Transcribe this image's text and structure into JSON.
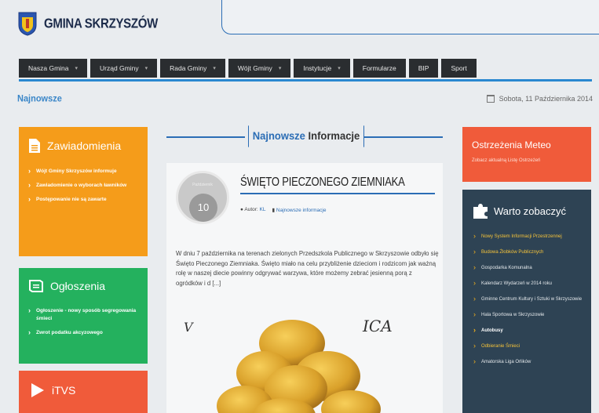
{
  "header": {
    "site_name": "GMINA SKRZYSZÓW"
  },
  "nav": {
    "items": [
      {
        "label": "Nasza Gmina",
        "has_dropdown": true
      },
      {
        "label": "Urząd Gminy",
        "has_dropdown": true
      },
      {
        "label": "Rada Gminy",
        "has_dropdown": true
      },
      {
        "label": "Wójt Gminy",
        "has_dropdown": true
      },
      {
        "label": "Instytucje",
        "has_dropdown": true
      },
      {
        "label": "Formularze",
        "has_dropdown": false
      },
      {
        "label": "BIP",
        "has_dropdown": false
      },
      {
        "label": "Sport",
        "has_dropdown": false
      }
    ]
  },
  "breadcrumb": "Najnowsze",
  "date": "Sobota, 11 Października 2014",
  "left": {
    "zawiadomienia": {
      "title": "Zawiadomienia",
      "items": [
        "Wójt Gminy Skrzyszów informuje",
        "Zawiadomienie o wyborach ławników",
        "Postępowanie nie są zawarte"
      ]
    },
    "ogloszenia": {
      "title": "Ogłoszenia",
      "items": [
        "Ogłoszenie - nowy sposób segregowania śmieci",
        "Zwrot podatku akcyzowego"
      ]
    },
    "itvs": {
      "title": "iTVS"
    }
  },
  "main": {
    "section_title_highlight": "Najnowsze",
    "section_title_rest": "Informacje",
    "article": {
      "day": "10",
      "month": "Październik",
      "title": "ŚWIĘTO PIECZONEGO ZIEMNIAKA",
      "author_label": "Autor:",
      "author_name": "KL",
      "category": "Najnowsze informacje",
      "body": "W dniu 7 października na terenach zielonych Przedszkola Publicznego w Skrzyszowie odbyło się Święto Pieczonego Ziemniaka. Święto miało na celu przybliżenie dzieciom i rodzicom jak ważną rolę w naszej diecie powinny odgrywać warzywa, które możemy zebrać jesienną porą z ogródków i d [...]",
      "image_text_left": "V",
      "image_text_right": "ICA"
    }
  },
  "right": {
    "meteo": {
      "title": "Ostrzeżenia Meteo",
      "subtitle": "Zobacz aktualną Listę Ostrzeżeń"
    },
    "warto": {
      "title": "Warto zobaczyć",
      "items": [
        {
          "label": "Nowy System Informacji Przestrzennej",
          "style": "y"
        },
        {
          "label": "Budowa Żłobków Publicznych",
          "style": "y"
        },
        {
          "label": "Gospodarka Komunalna",
          "style": "w"
        },
        {
          "label": "Kalendarz Wydarzeń w 2014 roku",
          "style": "w"
        },
        {
          "label": "Gminne Centrum Kultury i Sztuki w Skrzyszowie",
          "style": "w"
        },
        {
          "label": "Hala Sportowa w Skrzyszowie",
          "style": "w"
        },
        {
          "label": "Autobusy",
          "style": "b"
        },
        {
          "label": "Odbieranie Śmieci",
          "style": "y"
        },
        {
          "label": "Amatorska Liga Orlików",
          "style": "w"
        }
      ]
    }
  },
  "colors": {
    "accent_blue": "#2b6db5",
    "orange": "#f59c1a",
    "green": "#24b15e",
    "red": "#f05b3a",
    "navy": "#2e4354",
    "nav_bg": "#2a2d30"
  }
}
